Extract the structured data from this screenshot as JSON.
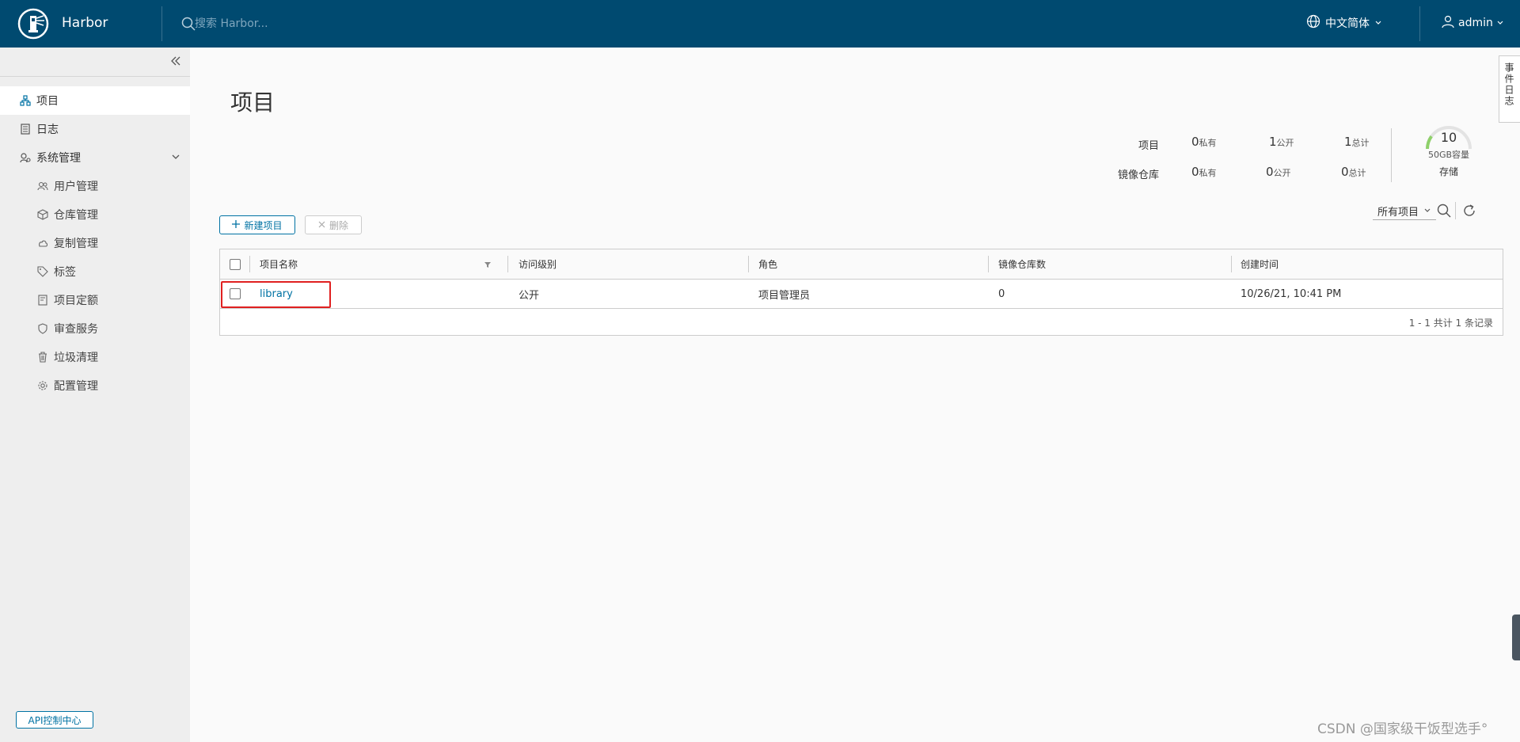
{
  "header": {
    "brand": "Harbor",
    "search_placeholder": "搜索 Harbor...",
    "language": "中文简体",
    "user": "admin"
  },
  "sidebar": {
    "items": [
      {
        "label": "项目",
        "icon": "projects-icon",
        "active": true
      },
      {
        "label": "日志",
        "icon": "logs-icon"
      },
      {
        "label": "系统管理",
        "icon": "admin-icon",
        "expanded": true
      }
    ],
    "subitems": [
      {
        "label": "用户管理",
        "icon": "users-icon"
      },
      {
        "label": "仓库管理",
        "icon": "registry-icon"
      },
      {
        "label": "复制管理",
        "icon": "replication-icon"
      },
      {
        "label": "标签",
        "icon": "tag-icon"
      },
      {
        "label": "项目定额",
        "icon": "quota-icon"
      },
      {
        "label": "审查服务",
        "icon": "shield-icon"
      },
      {
        "label": "垃圾清理",
        "icon": "trash-icon"
      },
      {
        "label": "配置管理",
        "icon": "gear-icon"
      }
    ],
    "api_button": "API控制中心"
  },
  "page": {
    "title": "项目",
    "event_tab": "事件日志"
  },
  "stats": {
    "rows": [
      {
        "label": "项目",
        "private": "0",
        "public": "1",
        "total": "1"
      },
      {
        "label": "镜像仓库",
        "private": "0",
        "public": "0",
        "total": "0"
      }
    ],
    "private_label": "私有",
    "public_label": "公开",
    "total_label": "总计",
    "gauge_value": "10",
    "gauge_caption": "50GB容量",
    "gauge_title": "存储",
    "gauge_fill": 0.2
  },
  "toolbar": {
    "new_project": "新建项目",
    "delete": "删除",
    "filter_selected": "所有项目"
  },
  "table": {
    "columns": [
      "项目名称",
      "访问级别",
      "角色",
      "镜像仓库数",
      "创建时间"
    ],
    "rows": [
      {
        "name": "library",
        "access": "公开",
        "role": "项目管理员",
        "repo_count": "0",
        "created": "10/26/21, 10:41 PM"
      }
    ],
    "footer": "1 - 1 共计 1 条记录"
  },
  "watermark": "CSDN @国家级干饭型选手°",
  "colors": {
    "header_bg": "#004a70",
    "accent": "#0072a3",
    "highlight": "#e02020"
  }
}
